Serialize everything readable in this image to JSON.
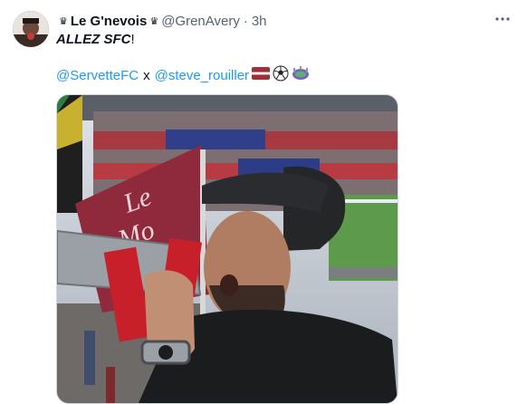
{
  "tweet": {
    "author_name": "Le G'nevois",
    "verified_emoji": "♛",
    "handle": "@GrenAvery",
    "separator": "·",
    "timestamp": "3h",
    "text_main": "ALLEZ SFC",
    "text_suffix": "!",
    "mention_1": "@ServetteFC",
    "connector": "x",
    "mention_2": "@steve_rouiller"
  },
  "icons": {
    "more": "more-options-icon",
    "flag": "latvia-flag-icon",
    "ball": "soccer-ball-icon",
    "stadium": "stadium-icon"
  },
  "colors": {
    "link": "#1d9bf0",
    "secondary": "#536471",
    "flag_red": "#9e3039"
  },
  "media": {
    "flag_text": "Le\nMo"
  }
}
